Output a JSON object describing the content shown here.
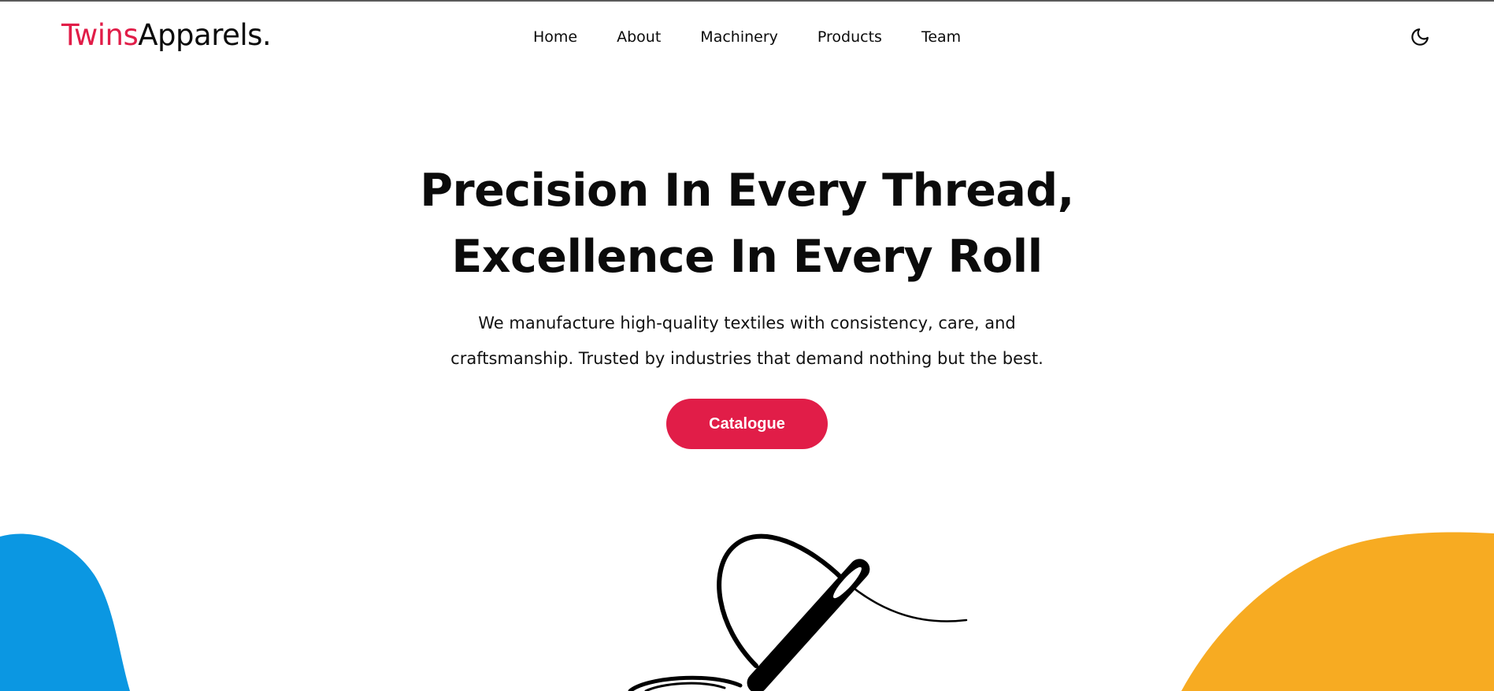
{
  "brand": {
    "accent_part": "Twins",
    "rest_part": "Apparels."
  },
  "nav": {
    "items": [
      {
        "label": "Home"
      },
      {
        "label": "About"
      },
      {
        "label": "Machinery"
      },
      {
        "label": "Products"
      },
      {
        "label": "Team"
      }
    ],
    "theme_icon": "moon-icon"
  },
  "hero": {
    "title_line1": "Precision In Every Thread,",
    "title_line2": "Excellence In Every Roll",
    "subtitle_line1": "We manufacture high-quality textiles with consistency, care, and",
    "subtitle_line2": "craftsmanship. Trusted by industries that demand nothing but the best.",
    "cta_label": "Catalogue"
  },
  "illustration": {
    "icon": "needle-thread-icon"
  },
  "colors": {
    "accent": "#e11d48",
    "blob_left": "#0b97e2",
    "blob_right": "#f7ab22",
    "text": "#0b0b0b"
  }
}
